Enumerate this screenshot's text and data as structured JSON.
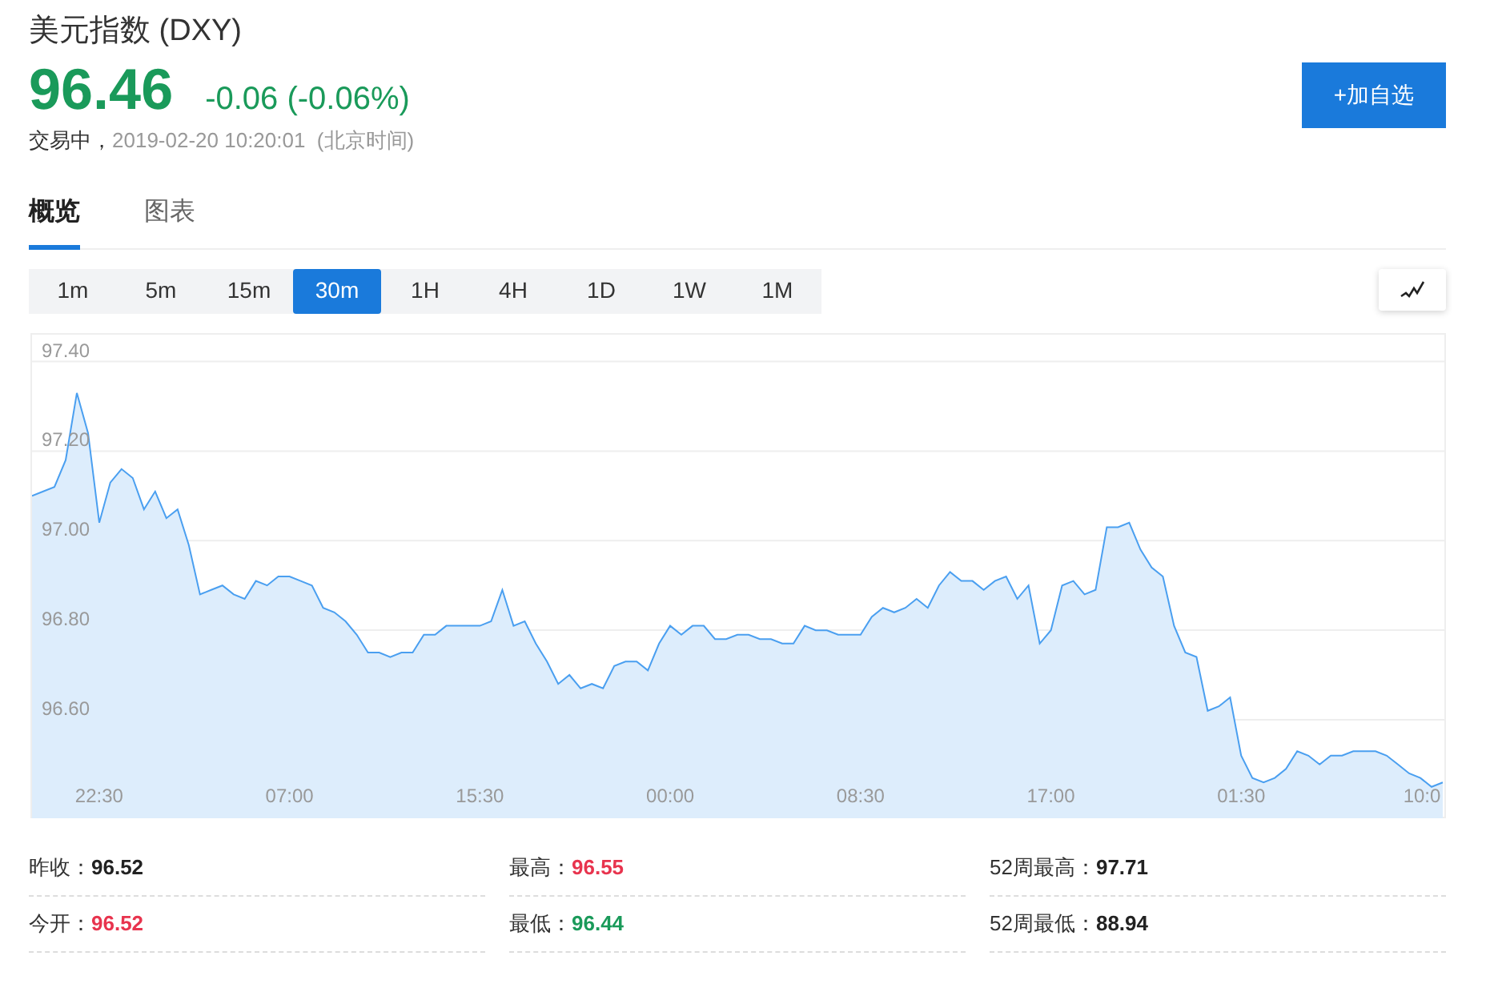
{
  "title": "美元指数 (DXY)",
  "quote": {
    "price": "96.46",
    "change": "-0.06 (-0.06%)",
    "color": "#1a9a5a"
  },
  "status": {
    "state": "交易中，",
    "time": "2019-02-20 10:20:01",
    "zone": "(北京时间)"
  },
  "add_button": "+加自选",
  "tabs": [
    {
      "label": "概览",
      "selected": true
    },
    {
      "label": "图表",
      "selected": false
    }
  ],
  "periods": [
    {
      "label": "1m",
      "selected": false
    },
    {
      "label": "5m",
      "selected": false
    },
    {
      "label": "15m",
      "selected": false
    },
    {
      "label": "30m",
      "selected": true
    },
    {
      "label": "1H",
      "selected": false
    },
    {
      "label": "4H",
      "selected": false
    },
    {
      "label": "1D",
      "selected": false
    },
    {
      "label": "1W",
      "selected": false
    },
    {
      "label": "1M",
      "selected": false
    }
  ],
  "chart": {
    "chart_data": {
      "type": "area",
      "grid": true,
      "ylim": [
        96.38,
        97.46
      ],
      "categories": [
        null,
        null,
        null,
        null,
        null,
        null,
        "22:30",
        null,
        null,
        null,
        null,
        null,
        null,
        null,
        null,
        null,
        null,
        null,
        null,
        null,
        null,
        null,
        null,
        "07:00",
        null,
        null,
        null,
        null,
        null,
        null,
        null,
        null,
        null,
        null,
        null,
        null,
        null,
        null,
        null,
        null,
        "15:30",
        null,
        null,
        null,
        null,
        null,
        null,
        null,
        null,
        null,
        null,
        null,
        null,
        null,
        null,
        null,
        null,
        "00:00",
        null,
        null,
        null,
        null,
        null,
        null,
        null,
        null,
        null,
        null,
        null,
        null,
        null,
        null,
        null,
        null,
        "08:30",
        null,
        null,
        null,
        null,
        null,
        null,
        null,
        null,
        null,
        null,
        null,
        null,
        null,
        null,
        null,
        null,
        "17:00",
        null,
        null,
        null,
        null,
        null,
        null,
        null,
        null,
        null,
        null,
        null,
        null,
        null,
        null,
        null,
        null,
        "01:30",
        null,
        null,
        null,
        null,
        null,
        null,
        null,
        null,
        null,
        null,
        null,
        null,
        null,
        null,
        null,
        null,
        "10:0",
        null
      ],
      "yticks": [
        {
          "value": 96.6,
          "label": "96.60"
        },
        {
          "value": 96.8,
          "label": "96.80"
        },
        {
          "value": 97.0,
          "label": "97.00"
        },
        {
          "value": 97.2,
          "label": "97.20"
        },
        {
          "value": 97.4,
          "label": "97.40"
        }
      ],
      "series": [
        {
          "color": "#4a9ff0",
          "values": [
            97.1,
            97.11,
            97.12,
            97.18,
            97.33,
            97.24,
            97.04,
            97.13,
            97.16,
            97.14,
            97.07,
            97.11,
            97.05,
            97.07,
            96.99,
            96.88,
            96.89,
            96.9,
            96.88,
            96.87,
            96.91,
            96.9,
            96.92,
            96.92,
            96.91,
            96.9,
            96.85,
            96.84,
            96.82,
            96.79,
            96.75,
            96.75,
            96.74,
            96.75,
            96.75,
            96.79,
            96.79,
            96.81,
            96.81,
            96.81,
            96.81,
            96.82,
            96.89,
            96.81,
            96.82,
            96.77,
            96.73,
            96.68,
            96.7,
            96.67,
            96.68,
            96.67,
            96.72,
            96.73,
            96.73,
            96.71,
            96.77,
            96.81,
            96.79,
            96.81,
            96.81,
            96.78,
            96.78,
            96.79,
            96.79,
            96.78,
            96.78,
            96.77,
            96.77,
            96.81,
            96.8,
            96.8,
            96.79,
            96.79,
            96.79,
            96.83,
            96.85,
            96.84,
            96.85,
            96.87,
            96.85,
            96.9,
            96.93,
            96.91,
            96.91,
            96.89,
            96.91,
            96.92,
            96.87,
            96.9,
            96.77,
            96.8,
            96.9,
            96.91,
            96.88,
            96.89,
            97.03,
            97.03,
            97.04,
            96.98,
            96.94,
            96.92,
            96.81,
            96.75,
            96.74,
            96.62,
            96.63,
            96.65,
            96.52,
            96.47,
            96.46,
            96.47,
            96.49,
            96.53,
            96.52,
            96.5,
            96.52,
            96.52,
            96.53,
            96.53,
            96.53,
            96.52,
            96.5,
            96.48,
            96.47,
            96.45,
            96.46
          ]
        }
      ]
    }
  },
  "stats": [
    {
      "label": "昨收：",
      "value": "96.52",
      "color": "#222222"
    },
    {
      "label": "最高：",
      "value": "96.55",
      "color": "#e8344e"
    },
    {
      "label": "52周最高：",
      "value": "97.71",
      "color": "#222222"
    },
    {
      "label": "今开：",
      "value": "96.52",
      "color": "#e8344e"
    },
    {
      "label": "最低：",
      "value": "96.44",
      "color": "#1a9a5a"
    },
    {
      "label": "52周最低：",
      "value": "88.94",
      "color": "#222222"
    }
  ]
}
